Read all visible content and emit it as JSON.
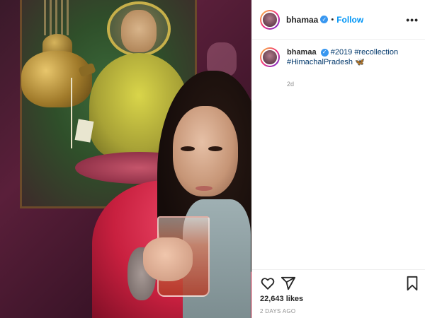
{
  "post": {
    "username": "bhamaa",
    "follow_label": "Follow",
    "separator": "•",
    "more_label": "•••",
    "verified_glyph": "✓",
    "caption": {
      "tags": [
        "#2019",
        "#recollection",
        "#HimachalPradesh"
      ],
      "emoji": "🦋"
    },
    "time_ago": "2d",
    "likes": "22,643 likes",
    "date": "2 DAYS AGO"
  },
  "icons": [
    "heart-icon",
    "share-icon",
    "bookmark-icon",
    "verified-icon",
    "more-icon"
  ],
  "colors": {
    "accent": "#0095f6",
    "verified": "#3897f0",
    "text": "#262626",
    "muted": "#8e8e8e",
    "hashtag": "#00376b"
  }
}
